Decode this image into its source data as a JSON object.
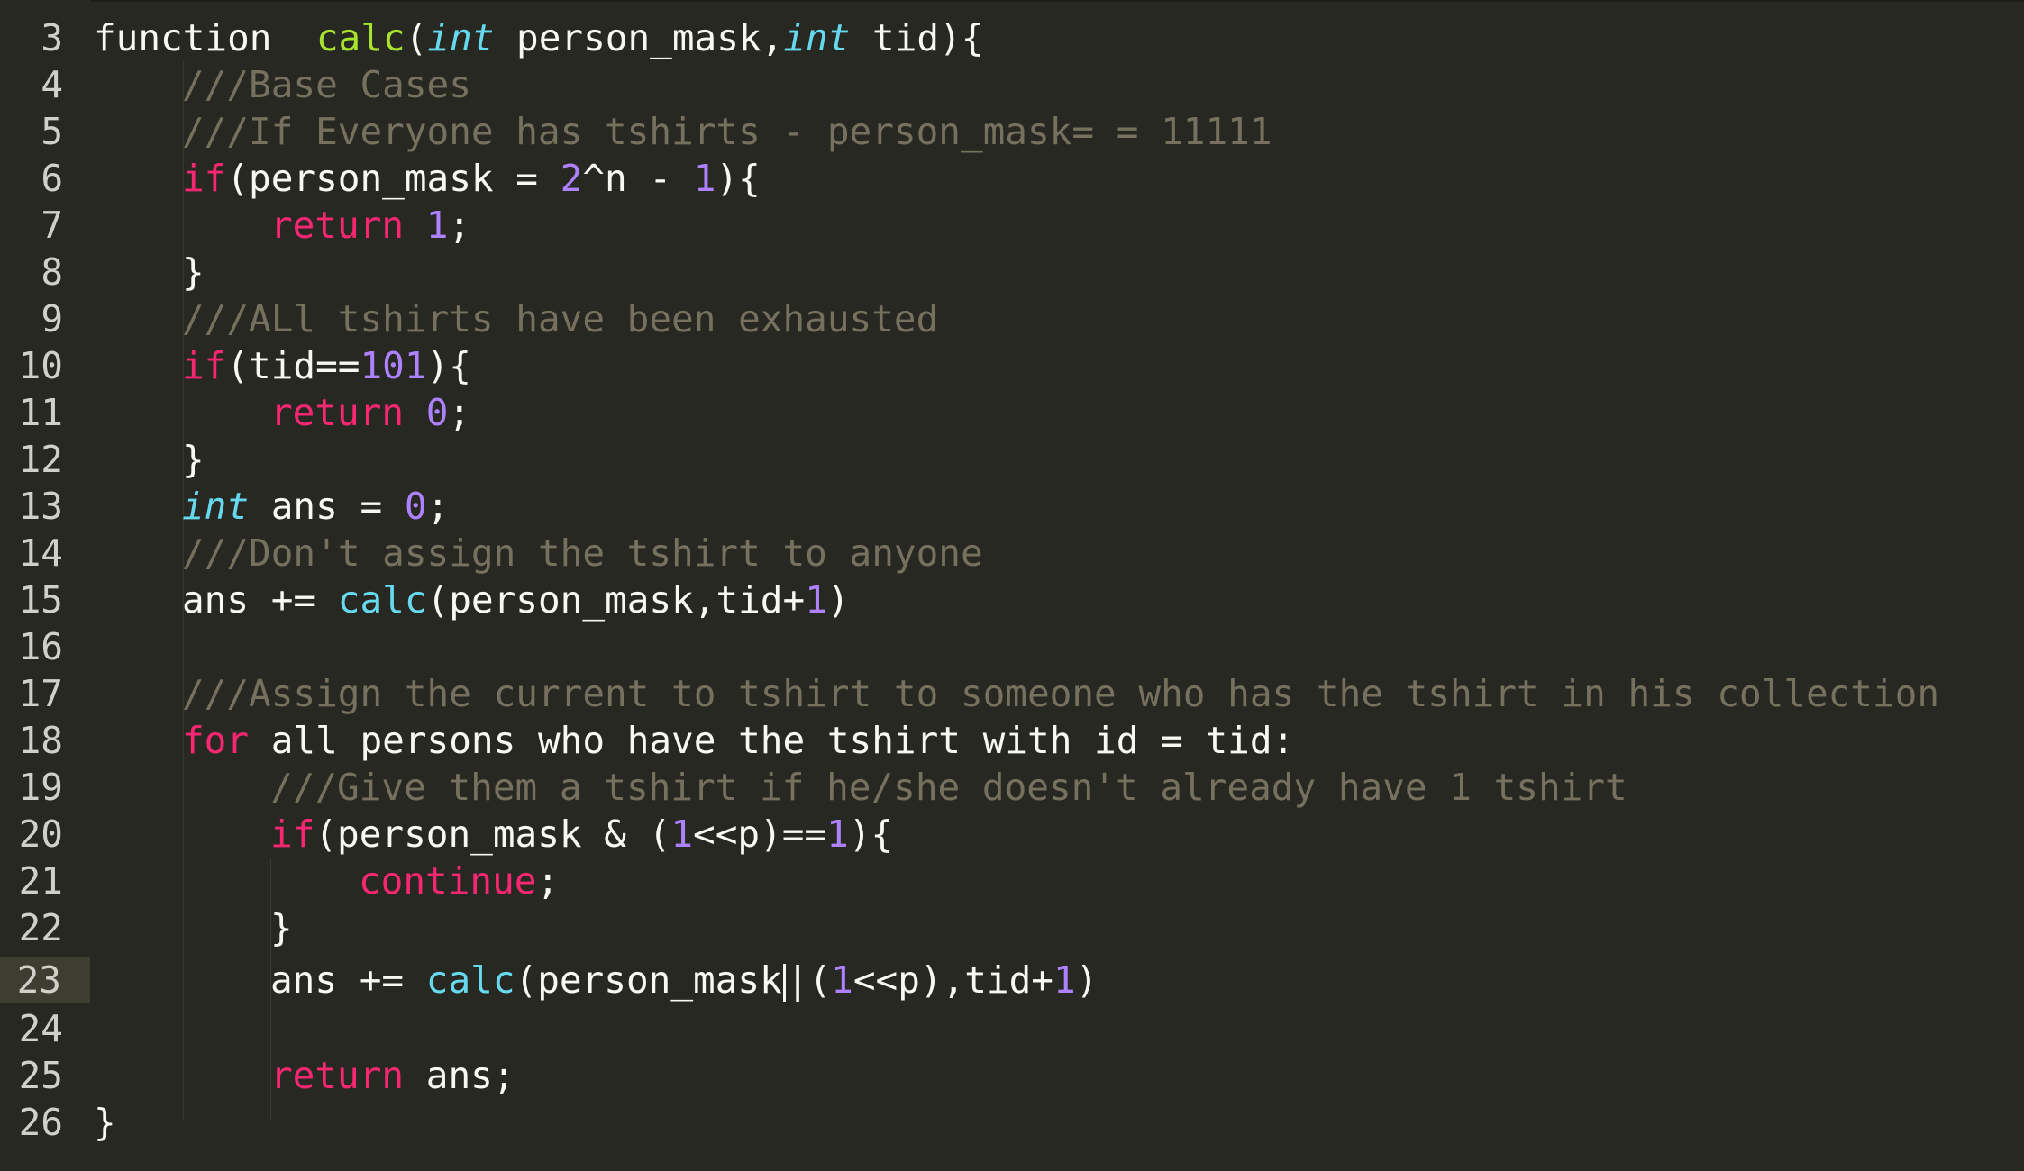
{
  "editor": {
    "theme_colors": {
      "background": "#272822",
      "keyword": "#f92672",
      "function_name": "#a6e22e",
      "call": "#66d9ef",
      "type": "#66d9ef",
      "number": "#ae81ff",
      "comment": "#75715e",
      "text": "#f8f8f2",
      "active_line": "#3e3d32"
    },
    "active_line_number": "23",
    "lines": [
      {
        "n": "3"
      },
      {
        "n": "4"
      },
      {
        "n": "5"
      },
      {
        "n": "6"
      },
      {
        "n": "7"
      },
      {
        "n": "8"
      },
      {
        "n": "9"
      },
      {
        "n": "10"
      },
      {
        "n": "11"
      },
      {
        "n": "12"
      },
      {
        "n": "13"
      },
      {
        "n": "14"
      },
      {
        "n": "15"
      },
      {
        "n": "16"
      },
      {
        "n": "17"
      },
      {
        "n": "18"
      },
      {
        "n": "19"
      },
      {
        "n": "20"
      },
      {
        "n": "21"
      },
      {
        "n": "22"
      },
      {
        "n": "23"
      },
      {
        "n": "24"
      },
      {
        "n": "25"
      },
      {
        "n": "26"
      }
    ],
    "code": {
      "l3": {
        "a": "function",
        "b": "calc",
        "c": "(",
        "d": "int",
        "e": " person_mask,",
        "f": "int",
        "g": " tid){"
      },
      "l4": {
        "a": "///Base Cases"
      },
      "l5": {
        "a": "///If Everyone has tshirts - person_mask= = 11111"
      },
      "l6": {
        "a": "if",
        "b": "(person_mask = ",
        "c": "2",
        "d": "^n - ",
        "e": "1",
        "f": "){"
      },
      "l7": {
        "a": "return",
        "b": " ",
        "c": "1",
        "d": ";"
      },
      "l8": {
        "a": "}"
      },
      "l9": {
        "a": "///ALl tshirts have been exhausted"
      },
      "l10": {
        "a": "if",
        "b": "(tid==",
        "c": "101",
        "d": "){"
      },
      "l11": {
        "a": "return",
        "b": " ",
        "c": "0",
        "d": ";"
      },
      "l12": {
        "a": "}"
      },
      "l13": {
        "a": "int",
        "b": " ans = ",
        "c": "0",
        "d": ";"
      },
      "l14": {
        "a": "///Don't assign the tshirt to anyone"
      },
      "l15": {
        "a": "ans += ",
        "b": "calc",
        "c": "(person_mask,tid+",
        "d": "1",
        "e": ")"
      },
      "l17": {
        "a": "///Assign the current to tshirt to someone who has the tshirt in his collection"
      },
      "l18": {
        "a": "for",
        "b": " all persons who have the tshirt with id = tid:"
      },
      "l19": {
        "a": "///Give them a tshirt if he/she doesn't already have 1 tshirt"
      },
      "l20": {
        "a": "if",
        "b": "(person_mask & (",
        "c": "1",
        "d": "<<p)==",
        "e": "1",
        "f": "){"
      },
      "l21": {
        "a": "continue",
        "b": ";"
      },
      "l22": {
        "a": "}"
      },
      "l23": {
        "a": "ans += ",
        "b": "calc",
        "c": "(person_mask",
        "d": "|(",
        "e": "1",
        "f": "<<p),tid+",
        "g": "1",
        "h": ")"
      },
      "l25": {
        "a": "return",
        "b": " ans;"
      },
      "l26": {
        "a": "}"
      }
    }
  }
}
